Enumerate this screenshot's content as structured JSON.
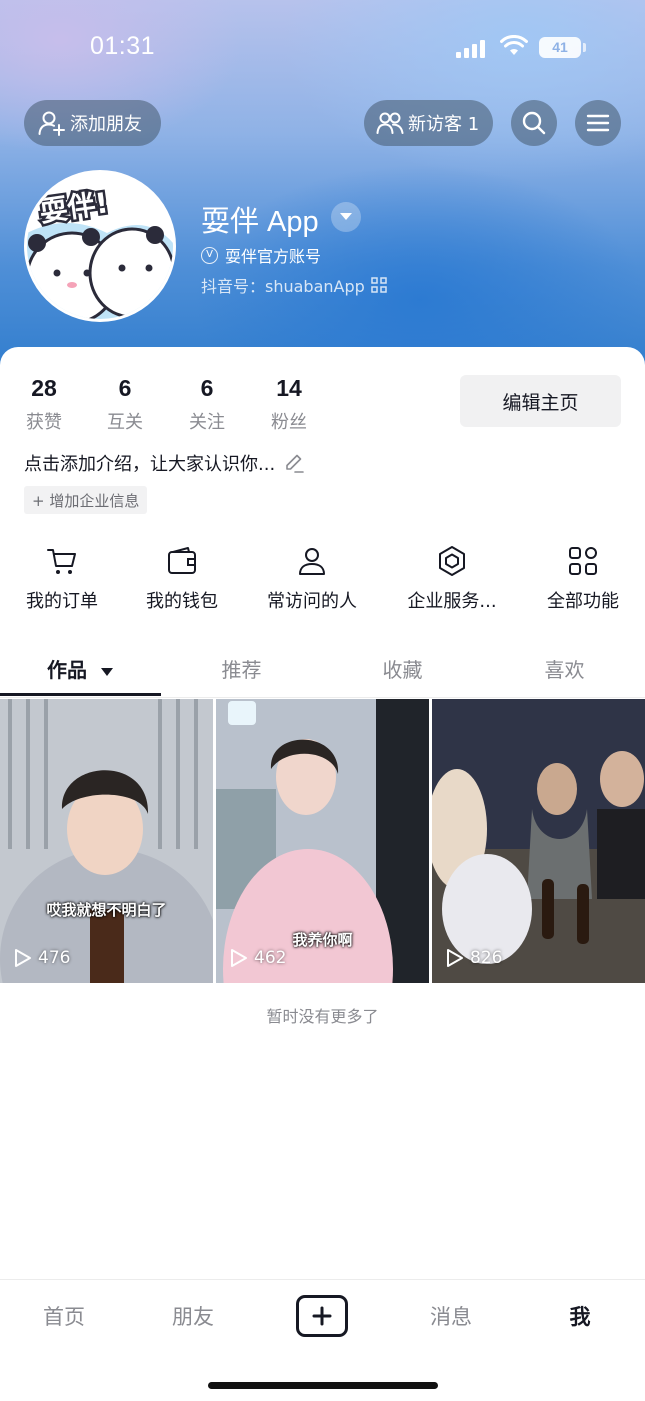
{
  "status_bar": {
    "time": "01:31",
    "battery": "41"
  },
  "header": {
    "add_friend_label": "添加朋友",
    "new_visitors_label": "新访客 1",
    "profile_name": "耍伴 App",
    "verified_label": "耍伴官方账号",
    "douyin_id": "抖音号：shuabanApp",
    "avatar_text": "耍伴!"
  },
  "stats": [
    {
      "value": "28",
      "label": "获赞"
    },
    {
      "value": "6",
      "label": "互关"
    },
    {
      "value": "6",
      "label": "关注"
    },
    {
      "value": "14",
      "label": "粉丝"
    }
  ],
  "edit_profile_label": "编辑主页",
  "bio": "点击添加介绍，让大家认识你...",
  "biz_tag": "+ 增加企业信息",
  "functions": [
    {
      "label": "我的订单",
      "icon": "cart-icon"
    },
    {
      "label": "我的钱包",
      "icon": "wallet-icon"
    },
    {
      "label": "常访问的人",
      "icon": "person-icon"
    },
    {
      "label": "企业服务...",
      "icon": "enterprise-icon"
    },
    {
      "label": "全部功能",
      "icon": "grid-icon"
    }
  ],
  "tabs": [
    {
      "label": "作品",
      "active": true
    },
    {
      "label": "推荐"
    },
    {
      "label": "收藏"
    },
    {
      "label": "喜欢"
    }
  ],
  "videos": [
    {
      "caption": "哎我就想不明白了",
      "plays": "476"
    },
    {
      "caption": "我养你啊",
      "plays": "462"
    },
    {
      "caption": "",
      "plays": "826"
    }
  ],
  "no_more": "暂时没有更多了",
  "bottom_nav": {
    "home": "首页",
    "friends": "朋友",
    "messages": "消息",
    "me": "我"
  },
  "colors": {
    "accent": "#161823",
    "header_blue": "#2f7ccd"
  }
}
